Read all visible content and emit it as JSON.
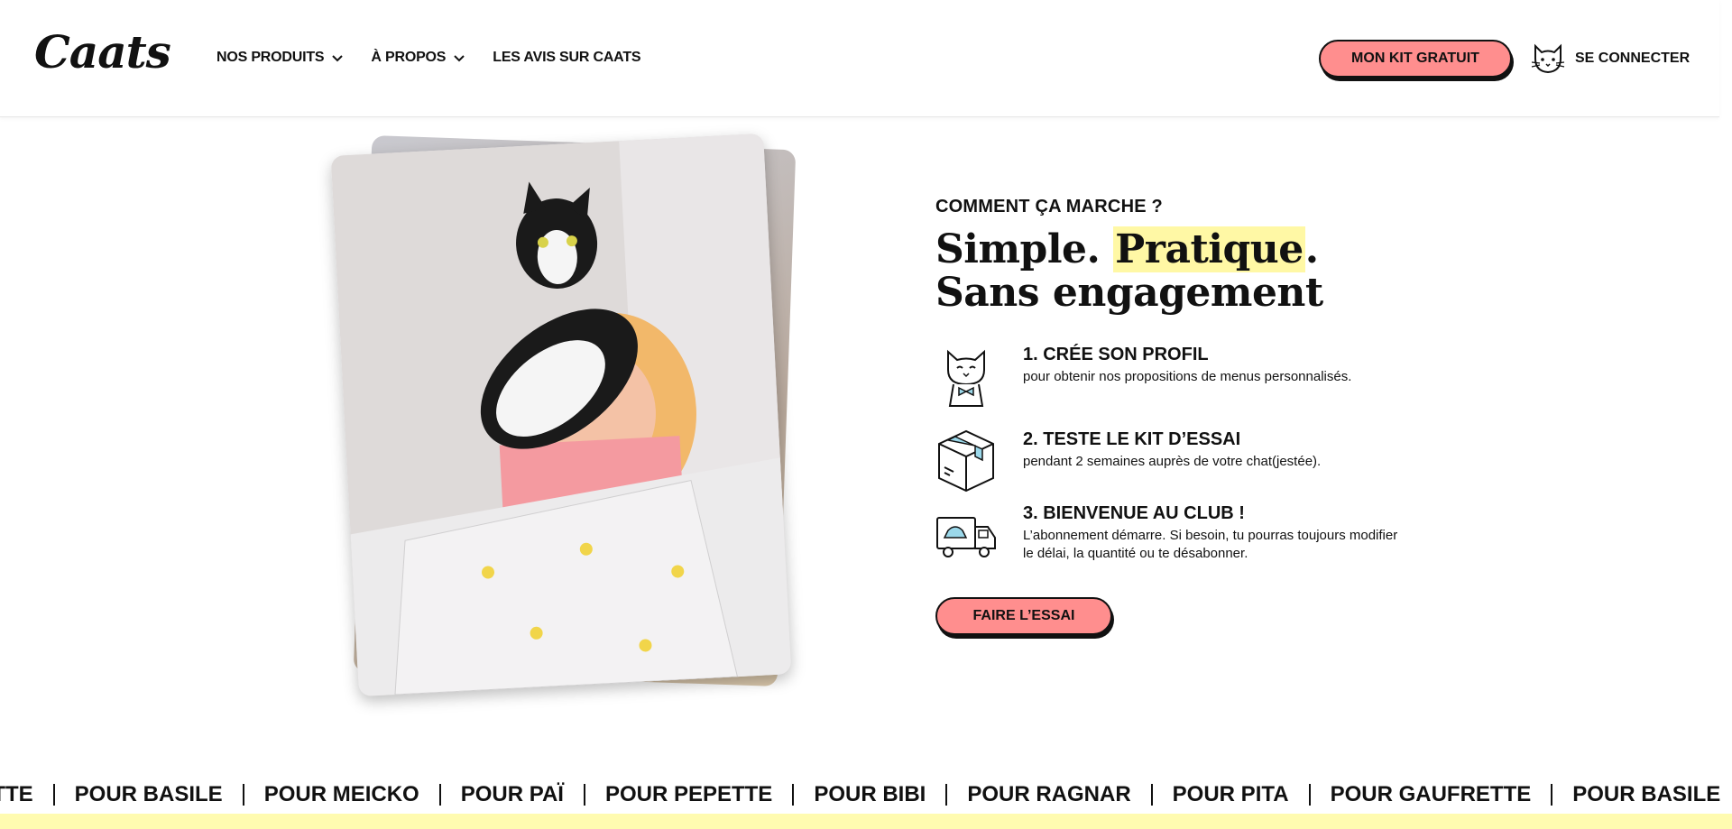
{
  "header": {
    "logo_text": "Caats",
    "nav": [
      {
        "label": "NOS PRODUITS",
        "has_dropdown": true
      },
      {
        "label": "À PROPOS",
        "has_dropdown": true
      },
      {
        "label": "LES AVIS SUR CAATS",
        "has_dropdown": false
      }
    ],
    "kit_button": "MON KIT GRATUIT",
    "login_label": "SE CONNECTER",
    "accent_color": "#ff8e8e"
  },
  "how_it_works": {
    "eyebrow": "COMMENT ÇA MARCHE ?",
    "headline_part1": "Simple. ",
    "headline_highlight": "Pratique",
    "headline_part2": ".",
    "headline_line2": "Sans engagement",
    "steps": [
      {
        "icon": "cat-bowtie-icon",
        "title": "1. CRÉE SON PROFIL",
        "desc": "pour obtenir nos propositions de menus personnalisés."
      },
      {
        "icon": "box-icon",
        "title": "2. TESTE LE KIT D’ESSAI",
        "desc": "pendant 2 semaines auprès de votre chat(jestée)."
      },
      {
        "icon": "delivery-truck-icon",
        "title": "3. BIENVENUE AU CLUB !",
        "desc": "L’abonnement démarre. Si besoin, tu pourras toujours modifier le délai, la quantité ou te désabonner."
      }
    ],
    "cta": "FAIRE L’ESSAI"
  },
  "marquee": [
    "RETTE",
    "POUR BASILE",
    "POUR MEICKO",
    "POUR PAÏ",
    "POUR PEPETTE",
    "POUR BIBI",
    "POUR RAGNAR",
    "POUR PITA",
    "POUR GAUFRETTE",
    "POUR BASILE"
  ],
  "colors": {
    "highlight": "#fff8a5",
    "band": "#fffbb0"
  }
}
